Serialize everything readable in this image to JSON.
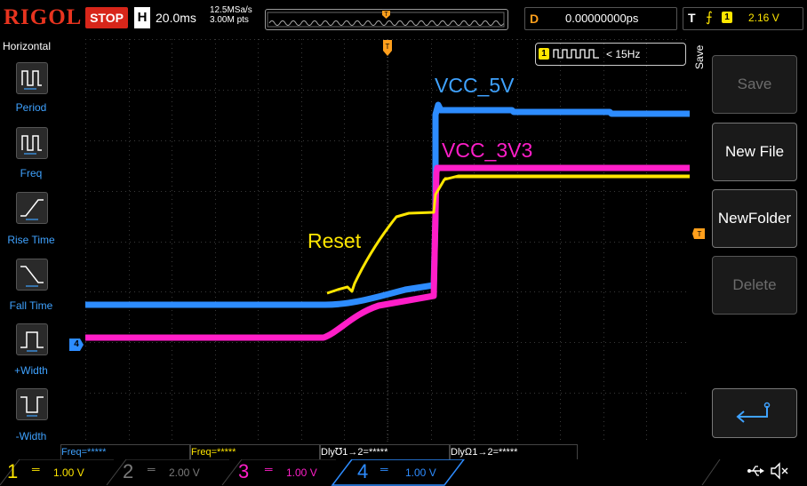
{
  "header": {
    "logo": "RIGOL",
    "run_state": "STOP",
    "timebase_label": "H",
    "timebase_value": "20.0ms",
    "sample_rate": "12.5MSa/s",
    "memory_depth": "3.00M pts",
    "delay_label": "D",
    "delay_value": "0.00000000ps",
    "trigger_label": "T",
    "trigger_source": "1",
    "trigger_level": "2.16 V"
  },
  "horizontal_menu": {
    "title": "Horizontal",
    "items": [
      {
        "label": "Period",
        "icon": "period-icon"
      },
      {
        "label": "Freq",
        "icon": "freq-icon"
      },
      {
        "label": "Rise Time",
        "icon": "rise-time-icon"
      },
      {
        "label": "Fall Time",
        "icon": "fall-time-icon"
      },
      {
        "label": "+Width",
        "icon": "positive-width-icon"
      },
      {
        "label": "-Width",
        "icon": "negative-width-icon"
      }
    ]
  },
  "save_menu": {
    "title": "Save",
    "buttons": [
      {
        "label": "Save",
        "enabled": false
      },
      {
        "label": "New File",
        "enabled": true
      },
      {
        "label": "NewFolder",
        "enabled": true
      },
      {
        "label": "Delete",
        "enabled": false
      }
    ],
    "enter_icon": "enter-arrow-icon"
  },
  "waveform": {
    "freq_counter_channel": "1",
    "freq_counter_value": "< 15Hz",
    "labels": {
      "vcc5": "VCC_5V",
      "vcc33": "VCC_3V3",
      "reset": "Reset"
    },
    "ground_marker": "4",
    "trigger_marker": "T"
  },
  "measurements": [
    {
      "text": "Freq=*****",
      "color": "#3fa2ff"
    },
    {
      "text": "Freq=*****",
      "color": "#ffe600"
    },
    {
      "text": "Dly℧1→2=*****",
      "color": "#ffffff"
    },
    {
      "text": "DlyΩ1→2=*****",
      "color": "#ffffff"
    }
  ],
  "channels": [
    {
      "num": "1",
      "scale": "1.00 V",
      "color": "#ffe600",
      "active": false
    },
    {
      "num": "2",
      "scale": "2.00 V",
      "color": "#7a7a7a",
      "active": false
    },
    {
      "num": "3",
      "scale": "1.00 V",
      "color": "#ff1ec8",
      "active": false
    },
    {
      "num": "4",
      "scale": "1.00 V",
      "color": "#2d8cff",
      "active": true
    }
  ],
  "status_icons": [
    "usb-icon",
    "speaker-muted-icon"
  ],
  "colors": {
    "ch1": "#ffe600",
    "ch3": "#ff1ec8",
    "ch4": "#2d8cff",
    "accent_orange": "#ff9f1c",
    "logo_red": "#e8341f"
  }
}
